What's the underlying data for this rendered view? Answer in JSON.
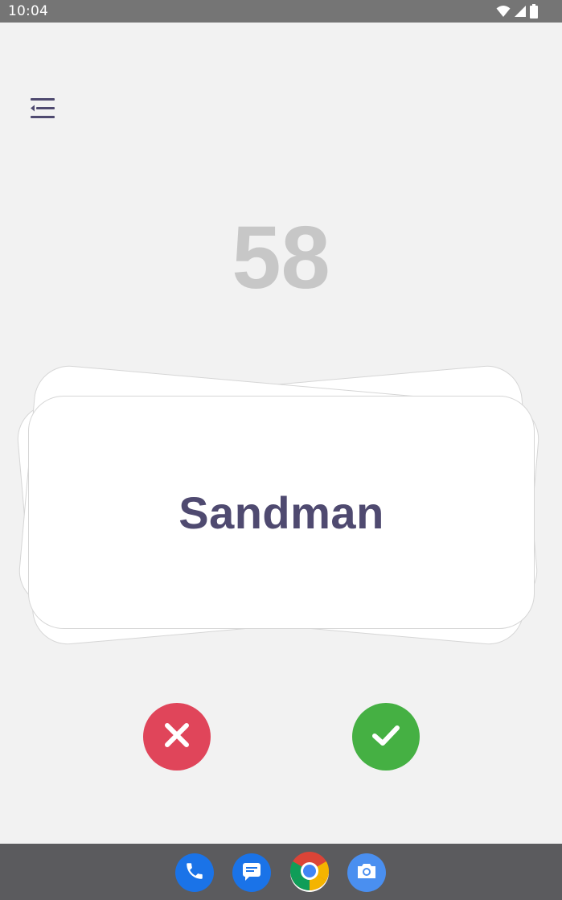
{
  "status_bar": {
    "time": "10:04",
    "icons": [
      "wifi-icon",
      "signal-icon",
      "battery-icon"
    ]
  },
  "app": {
    "menu_icon": "menu-collapse-icon",
    "counter": "58",
    "card": {
      "word": "Sandman"
    },
    "buttons": {
      "wrong": {
        "icon": "close-icon",
        "color": "#e0455a"
      },
      "correct": {
        "icon": "check-icon",
        "color": "#45b043"
      }
    }
  },
  "dock": {
    "apps": [
      {
        "name": "phone-icon",
        "color": "#1a73e8"
      },
      {
        "name": "messages-icon",
        "color": "#1a73e8"
      },
      {
        "name": "chrome-icon",
        "color": "#ffffff"
      },
      {
        "name": "camera-icon",
        "color": "#4a8ff0"
      }
    ]
  }
}
